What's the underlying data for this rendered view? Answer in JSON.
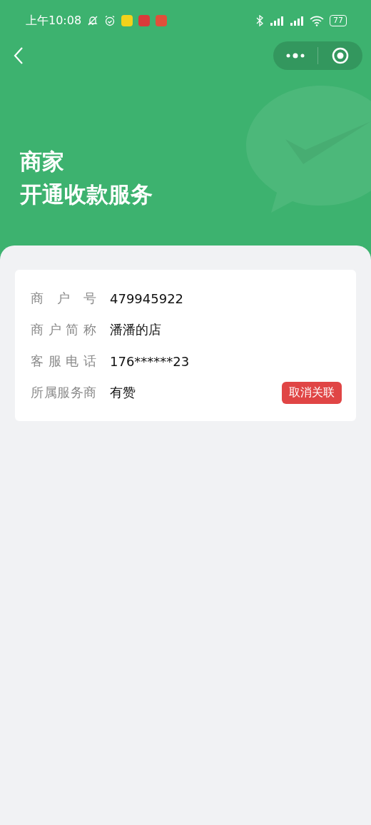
{
  "status_bar": {
    "time": "上午10:08",
    "battery": "77"
  },
  "header": {
    "title_lines": [
      "商家",
      "开通收款服务"
    ]
  },
  "info_rows": [
    {
      "label": "商户号",
      "value": "479945922"
    },
    {
      "label": "商户简称",
      "value": "潘潘的店"
    },
    {
      "label": "客服电话",
      "value": "176******23"
    },
    {
      "label": "所属服务商",
      "value": "有赞",
      "action": "取消关联"
    }
  ]
}
